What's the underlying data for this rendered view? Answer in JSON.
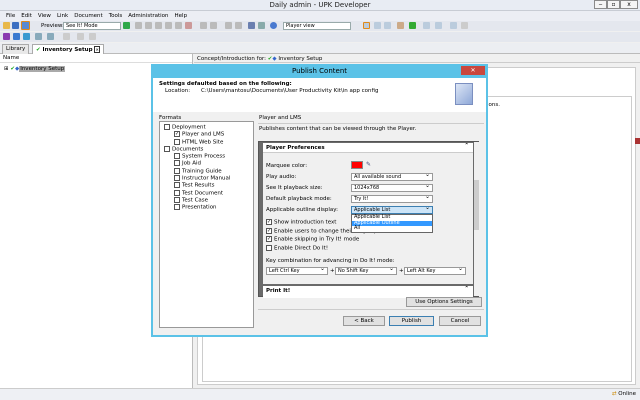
{
  "window": {
    "title": "Daily admin - UPK Developer",
    "min": "‒",
    "max": "▫",
    "close": "x"
  },
  "menu": [
    "File",
    "Edit",
    "View",
    "Link",
    "Document",
    "Tools",
    "Administration",
    "Help"
  ],
  "toolbar": {
    "preview_label": "Preview:",
    "preview_mode": "See It! Mode",
    "view_select": "Player view"
  },
  "tabs": [
    {
      "label": "Library"
    },
    {
      "label": "Inventory Setup"
    }
  ],
  "left_pane": {
    "header": "Name",
    "tree_item": "Inventory Setup"
  },
  "right_pane": {
    "concept_label": "Concept/Introduction for:",
    "concept_item": "Inventory Setup",
    "partial_text": "ions."
  },
  "status": {
    "online": "Online"
  },
  "dialog": {
    "title": "Publish Content",
    "heading": "Settings defaulted based on the following:",
    "location_label": "Location:",
    "location_value": "C:\\Users\\mantosu\\Documents\\User Productivity Kit\\in app config",
    "formats_label": "Formats",
    "formats": [
      {
        "label": "Deployment",
        "checked": false,
        "level": 0
      },
      {
        "label": "Player and LMS",
        "checked": true,
        "level": 1
      },
      {
        "label": "HTML Web Site",
        "checked": false,
        "level": 1
      },
      {
        "label": "Documents",
        "checked": false,
        "level": 0
      },
      {
        "label": "System Process",
        "checked": false,
        "level": 1
      },
      {
        "label": "Job Aid",
        "checked": false,
        "level": 1
      },
      {
        "label": "Training Guide",
        "checked": false,
        "level": 1
      },
      {
        "label": "Instructor Manual",
        "checked": false,
        "level": 1
      },
      {
        "label": "Test Results",
        "checked": false,
        "level": 1
      },
      {
        "label": "Test Document",
        "checked": false,
        "level": 1
      },
      {
        "label": "Test Case",
        "checked": false,
        "level": 1
      },
      {
        "label": "Presentation",
        "checked": false,
        "level": 1
      }
    ],
    "panel_title": "Player and LMS",
    "panel_desc": "Publishes content that can be viewed through the Player.",
    "section_title": "Player Preferences",
    "marquee_label": "Marquee color:",
    "marquee_color": "#ff0000",
    "play_audio_label": "Play audio:",
    "play_audio_value": "All available sound",
    "see_it_label": "See It playback size:",
    "see_it_value": "1024x768",
    "default_mode_label": "Default playback mode:",
    "default_mode_value": "Try It!",
    "outline_label": "Applicable outline display:",
    "outline_value": "Applicable List",
    "outline_options": [
      "Applicable List",
      "Applicable Outline",
      "All"
    ],
    "checkboxes": [
      {
        "label": "Show introduction text",
        "checked": true
      },
      {
        "label": "Enable users to change their Player preferences",
        "checked": true
      },
      {
        "label": "Enable skipping in Try It! mode",
        "checked": true
      },
      {
        "label": "Enable Direct Do It!",
        "checked": false
      }
    ],
    "key_combo_label": "Key combination for advancing in Do It! mode:",
    "key1": "Left Ctrl Key",
    "key2": "No Shift Key",
    "key3": "Left Alt Key",
    "plus": "+",
    "print_section": "Print It!",
    "use_options": "Use Options Settings",
    "back": "< Back",
    "publish": "Publish",
    "cancel": "Cancel"
  }
}
